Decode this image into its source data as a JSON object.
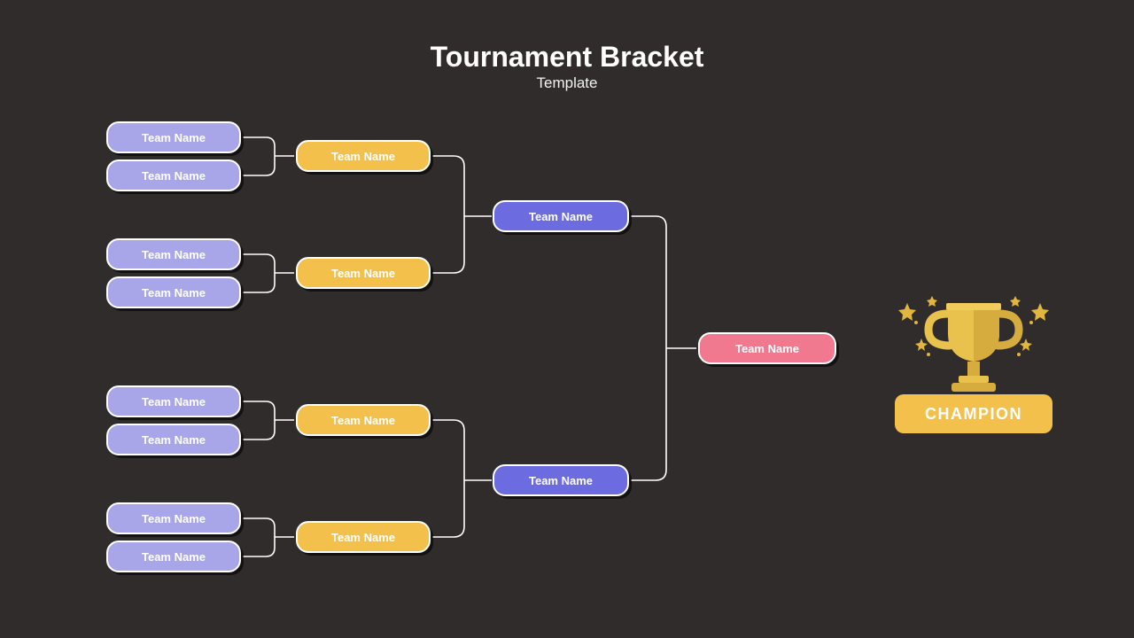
{
  "title": "Tournament Bracket",
  "subtitle": "Template",
  "champion_label": "CHAMPION",
  "round1": [
    {
      "label": "Team Name"
    },
    {
      "label": "Team Name"
    },
    {
      "label": "Team Name"
    },
    {
      "label": "Team Name"
    },
    {
      "label": "Team Name"
    },
    {
      "label": "Team Name"
    },
    {
      "label": "Team Name"
    },
    {
      "label": "Team Name"
    }
  ],
  "round2": [
    {
      "label": "Team Name"
    },
    {
      "label": "Team Name"
    },
    {
      "label": "Team Name"
    },
    {
      "label": "Team Name"
    }
  ],
  "round3": [
    {
      "label": "Team Name"
    },
    {
      "label": "Team Name"
    }
  ],
  "final": {
    "label": "Team Name"
  },
  "colors": {
    "bg": "#302c2c",
    "lavender": "#a8a6e8",
    "yellow": "#f3c14b",
    "blue": "#6c6be0",
    "pink": "#f0788f"
  }
}
